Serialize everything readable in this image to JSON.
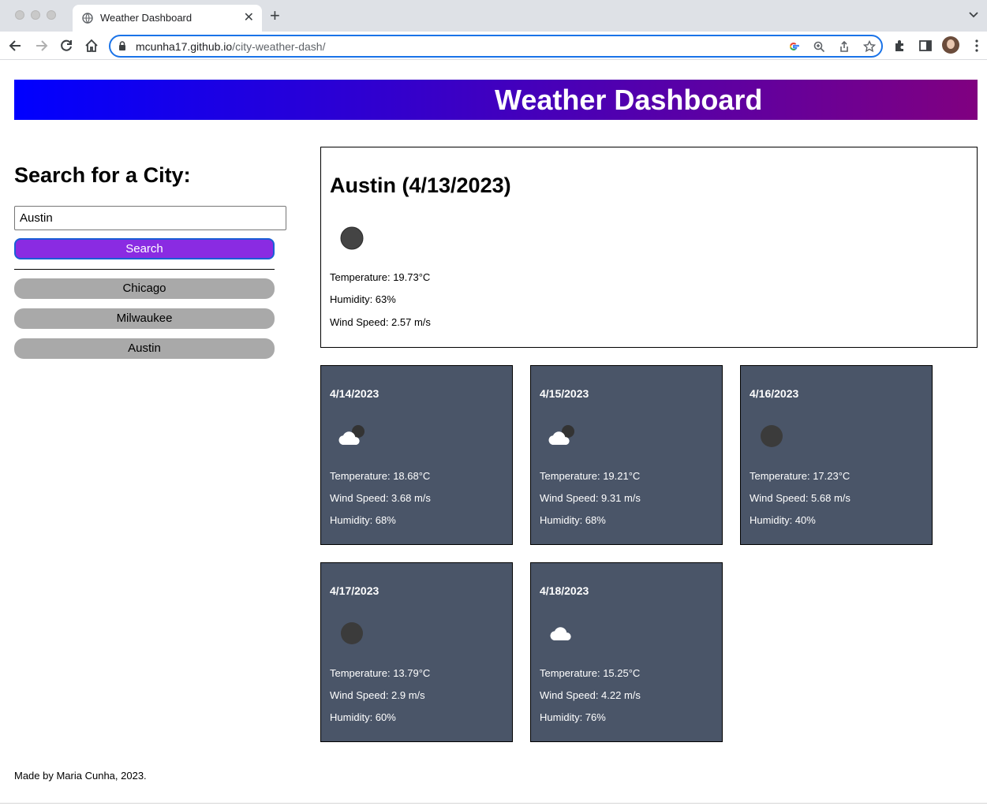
{
  "browser": {
    "tab_title": "Weather Dashboard",
    "url_domain": "mcunha17.github.io",
    "url_path": "/city-weather-dash/"
  },
  "page": {
    "heading": "Weather Dashboard",
    "search": {
      "title": "Search for a City:",
      "input_value": "Austin",
      "button_label": "Search"
    },
    "history": [
      "Chicago",
      "Milwaukee",
      "Austin"
    ],
    "current": {
      "title": "Austin (4/13/2023)",
      "icon": "moon-icon",
      "temperature": "Temperature: 19.73°C",
      "humidity": "Humidity: 63%",
      "wind": "Wind Speed: 2.57 m/s"
    },
    "forecast": [
      {
        "date": "4/14/2023",
        "icon": "cloud-night-icon",
        "temperature": "Temperature: 18.68°C",
        "wind": "Wind Speed: 3.68 m/s",
        "humidity": "Humidity: 68%"
      },
      {
        "date": "4/15/2023",
        "icon": "cloud-night-icon",
        "temperature": "Temperature: 19.21°C",
        "wind": "Wind Speed: 9.31 m/s",
        "humidity": "Humidity: 68%"
      },
      {
        "date": "4/16/2023",
        "icon": "moon-icon",
        "temperature": "Temperature: 17.23°C",
        "wind": "Wind Speed: 5.68 m/s",
        "humidity": "Humidity: 40%"
      },
      {
        "date": "4/17/2023",
        "icon": "moon-icon",
        "temperature": "Temperature: 13.79°C",
        "wind": "Wind Speed: 2.9 m/s",
        "humidity": "Humidity: 60%"
      },
      {
        "date": "4/18/2023",
        "icon": "cloud-icon",
        "temperature": "Temperature: 15.25°C",
        "wind": "Wind Speed: 4.22 m/s",
        "humidity": "Humidity: 76%"
      }
    ],
    "footer": "Made by Maria Cunha, 2023."
  },
  "colors": {
    "header_gradient_start": "#0000ff",
    "header_gradient_end": "#800080",
    "search_button": "#8a2be2",
    "history_button": "#a9a9a9",
    "forecast_card": "#4a5568"
  }
}
